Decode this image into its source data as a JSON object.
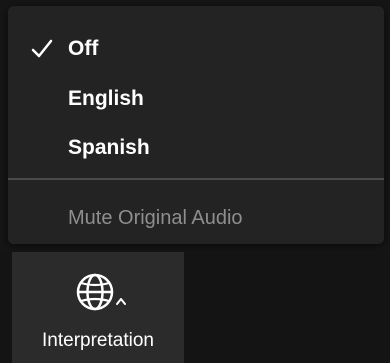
{
  "menu": {
    "items": [
      {
        "label": "Off",
        "checked": true
      },
      {
        "label": "English",
        "checked": false
      },
      {
        "label": "Spanish",
        "checked": false
      }
    ],
    "mute_label": "Mute Original Audio"
  },
  "toolbar": {
    "interpretation_label": "Interpretation",
    "icon": "globe-icon",
    "caret_icon": "caret-up-icon"
  },
  "colors": {
    "menu_bg": "#232323",
    "text": "#ffffff",
    "disabled_text": "#8e8e8e",
    "button_bg": "#2b2b2b"
  }
}
